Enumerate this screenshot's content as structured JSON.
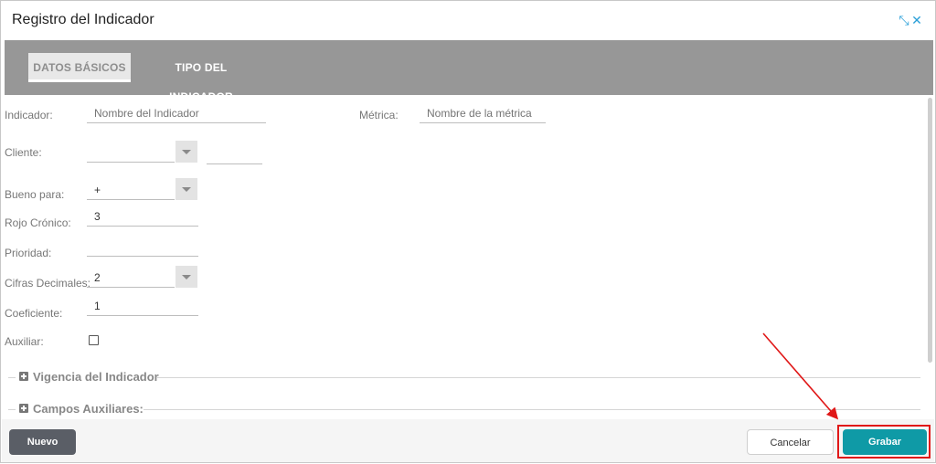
{
  "dialog": {
    "title": "Registro del Indicador",
    "controls": {
      "collapse": "⤡",
      "close": "✕"
    }
  },
  "tabs": [
    {
      "label": "DATOS BÁSICOS",
      "active": true
    },
    {
      "label": "TIPO DEL INDICADOR",
      "active": false
    }
  ],
  "form": {
    "indicador": {
      "label": "Indicador:",
      "placeholder": "Nombre del Indicador",
      "value": ""
    },
    "metrica": {
      "label": "Métrica:",
      "placeholder": "Nombre de la métrica",
      "value": ""
    },
    "cliente": {
      "label": "Cliente:",
      "value": "",
      "code": ""
    },
    "bueno_para": {
      "label": "Bueno para:",
      "value": "+"
    },
    "rojo_cronico": {
      "label": "Rojo Crónico:",
      "value": "3"
    },
    "prioridad": {
      "label": "Prioridad:",
      "value": ""
    },
    "cifras_decimales": {
      "label": "Cifras Decimales:",
      "value": "2"
    },
    "coeficiente": {
      "label": "Coeficiente:",
      "value": "1"
    },
    "auxiliar": {
      "label": "Auxiliar:",
      "checked": false
    }
  },
  "sections": [
    {
      "label": "Vigencia del Indicador",
      "expanded": false
    },
    {
      "label": "Campos Auxiliares:",
      "expanded": false
    }
  ],
  "footer": {
    "nuevo_label": "Nuevo",
    "cancelar_label": "Cancelar",
    "grabar_label": "Grabar"
  },
  "colors": {
    "tab_band": "#979797",
    "primary": "#0f9aa6",
    "dark_button": "#5a5e66",
    "highlight": "#e01818",
    "window_controls": "#2a9fd8"
  }
}
